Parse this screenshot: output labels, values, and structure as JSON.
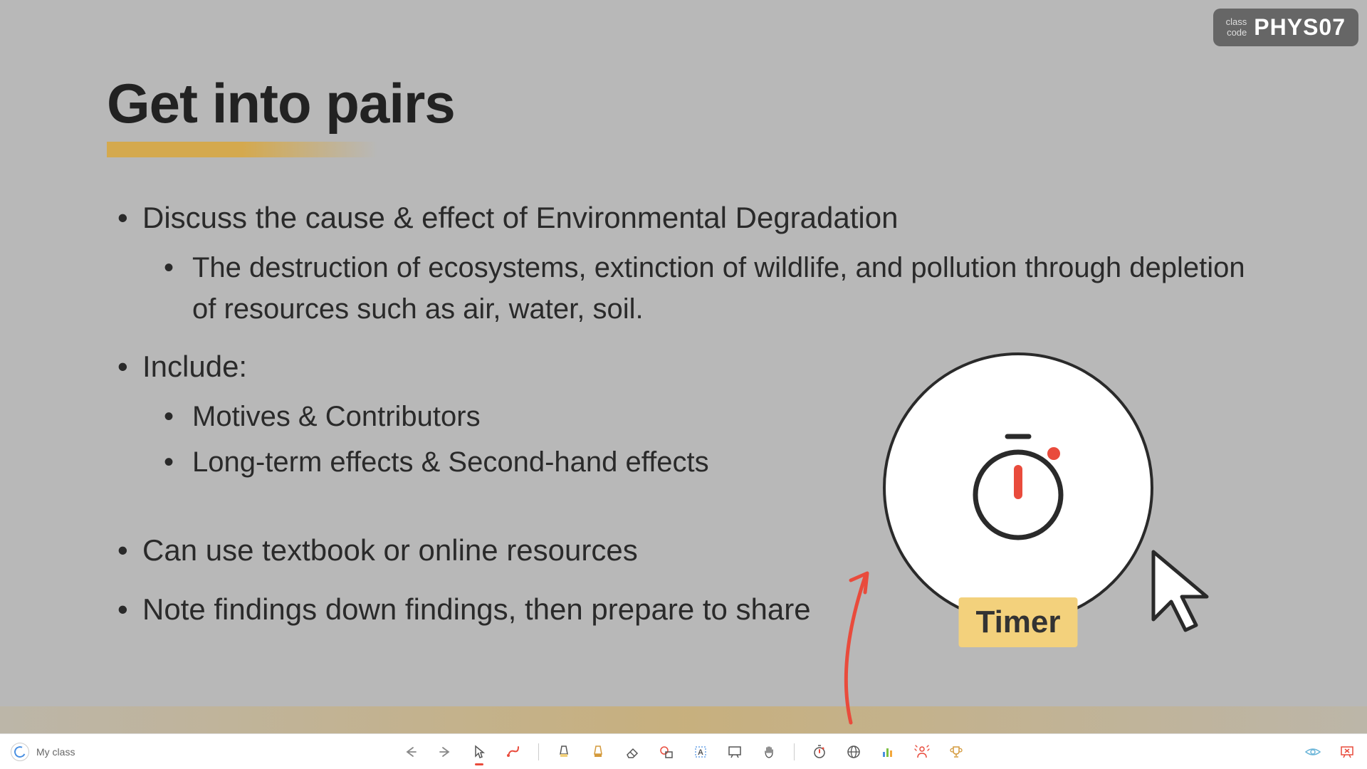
{
  "class_code": {
    "label": "class\ncode",
    "value": "PHYS07"
  },
  "slide": {
    "title": "Get into pairs",
    "bullets": [
      {
        "text": "Discuss the cause & effect of Environmental Degradation",
        "sub": [
          "The destruction of ecosystems, extinction of wildlife, and pollution through depletion of resources such as air, water, soil."
        ]
      },
      {
        "text": "Include:",
        "sub": [
          "Motives & Contributors",
          "Long-term effects & Second-hand effects"
        ]
      },
      {
        "text": "Can use textbook or online resources"
      },
      {
        "text": "Note findings down findings, then prepare to share"
      }
    ]
  },
  "callout": {
    "timer_label": "Timer"
  },
  "toolbar": {
    "my_class": "My class"
  }
}
